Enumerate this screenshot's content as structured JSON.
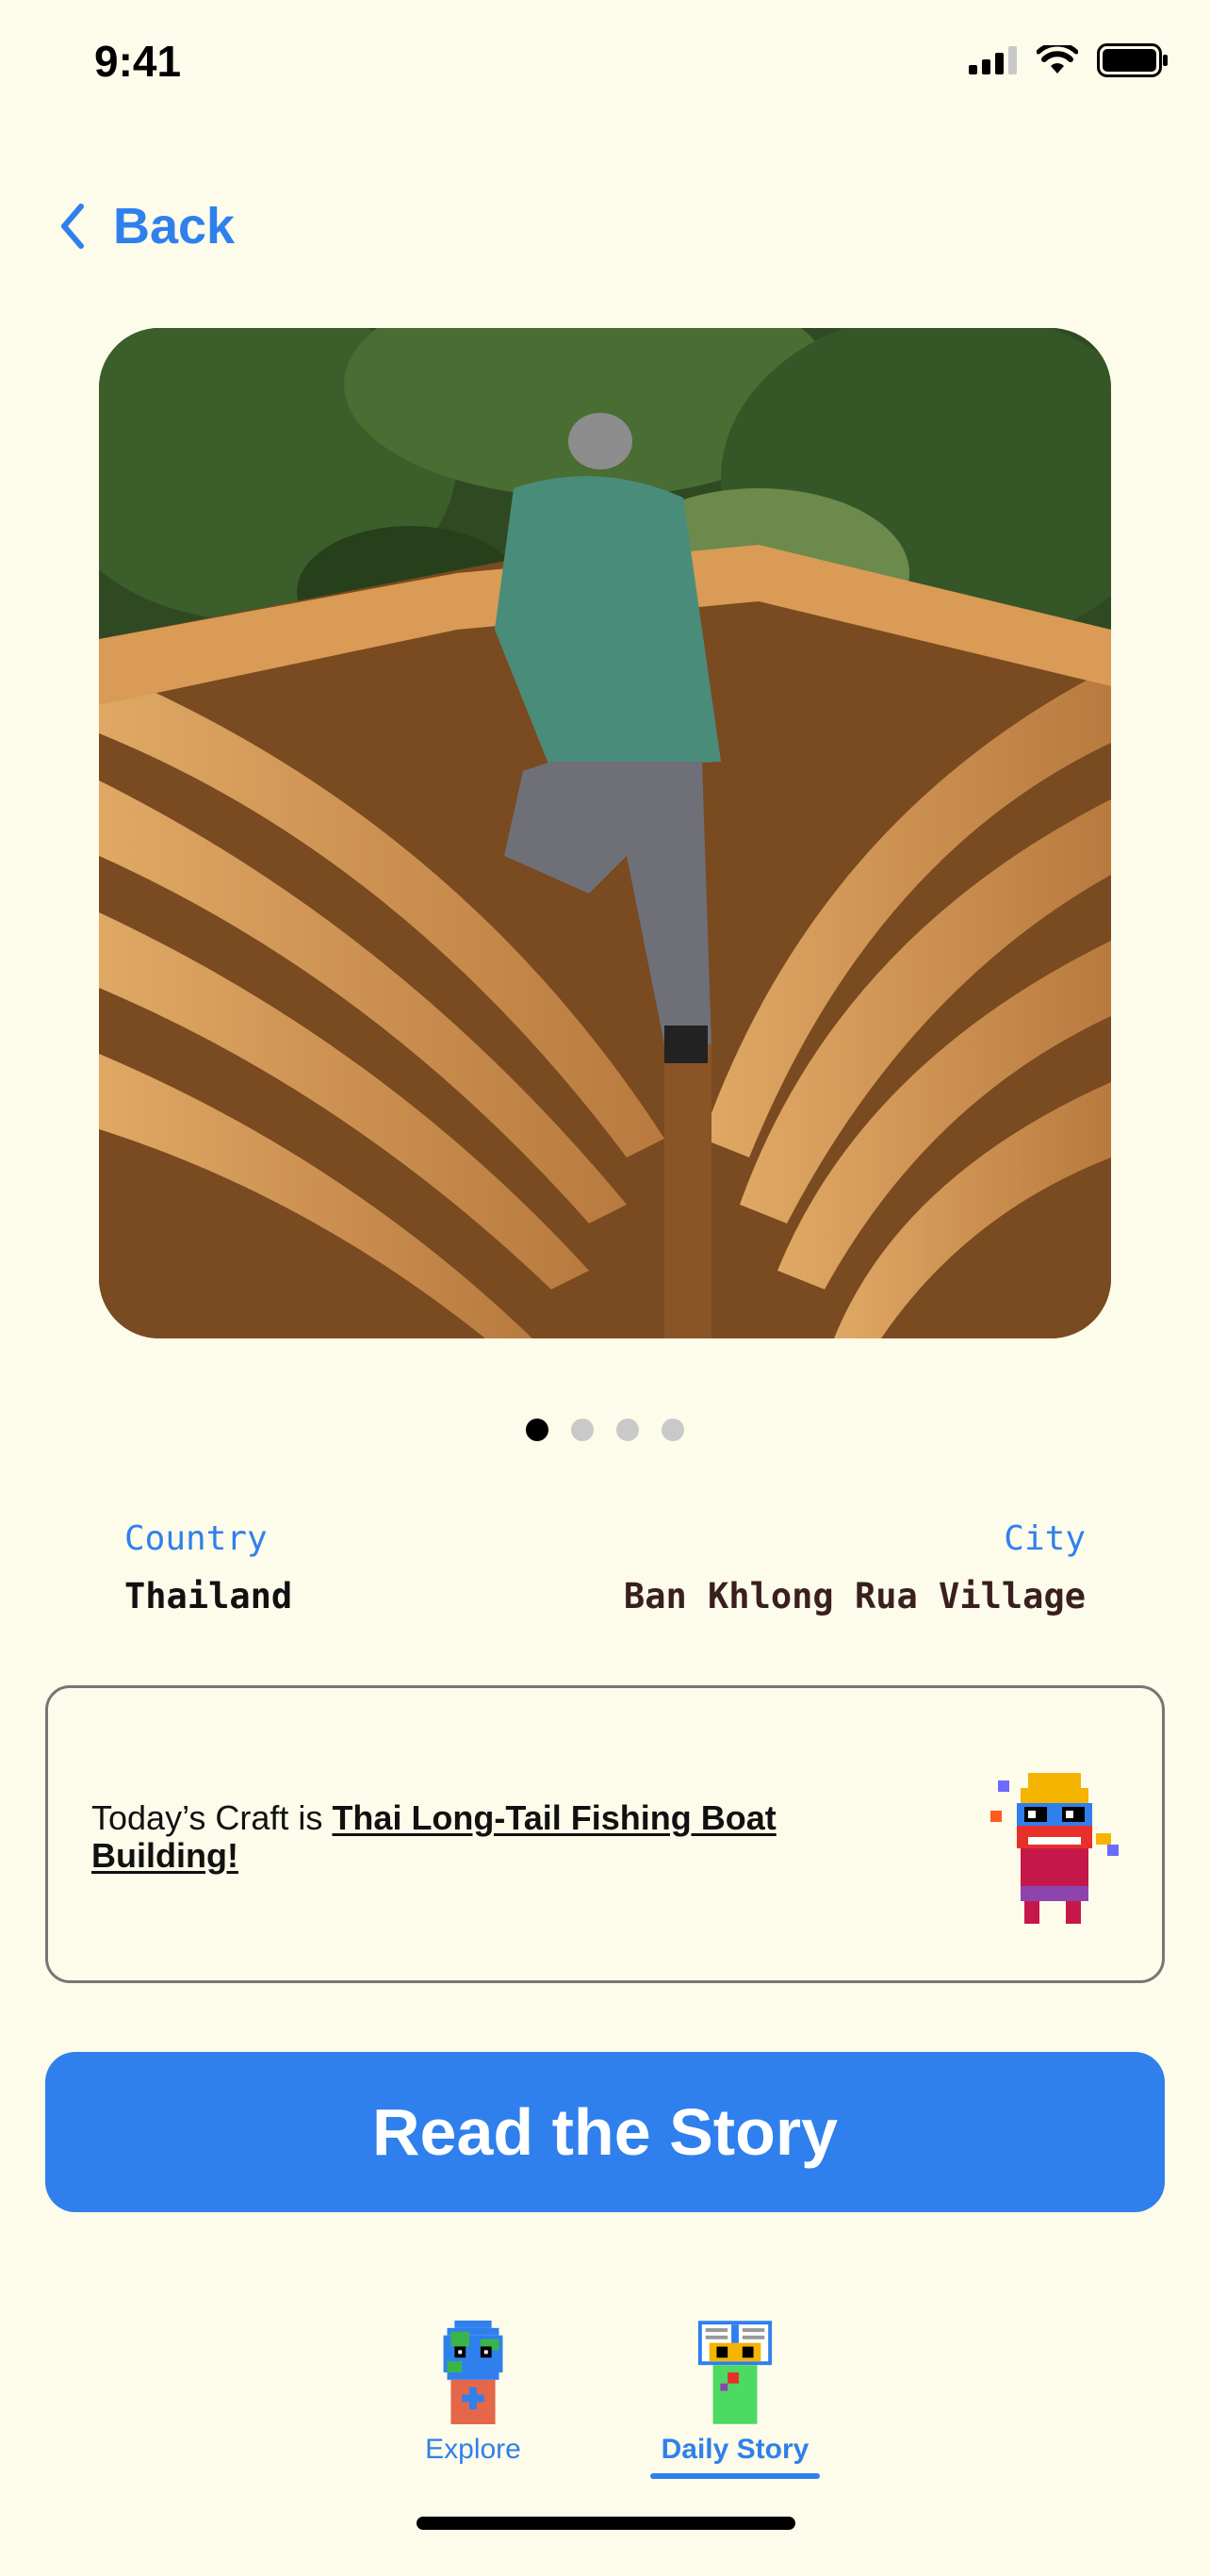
{
  "status_bar": {
    "time": "9:41",
    "icons": [
      "cellular-signal-icon",
      "wifi-icon",
      "battery-icon"
    ]
  },
  "nav": {
    "back_label": "Back",
    "back_icon": "chevron-left-icon"
  },
  "hero": {
    "image": "wooden-boat-hull-photo",
    "pager_total": 4,
    "pager_active_index": 0
  },
  "info": {
    "country_label": "Country",
    "country_value": "Thailand",
    "city_label": "City",
    "city_value": "Ban Khlong Rua Village"
  },
  "craft": {
    "prefix": "Today’s Craft is ",
    "name": "Thai Long-Tail Fishing Boat Building!",
    "mascot": "pixel-mascot-icon"
  },
  "cta": {
    "label": "Read the Story"
  },
  "tabbar": {
    "tabs": [
      {
        "label": "Explore",
        "icon": "globe-mascot-icon",
        "active": false
      },
      {
        "label": "Daily Story",
        "icon": "book-mascot-icon",
        "active": true
      }
    ]
  },
  "colors": {
    "background": "#fdfbea",
    "accent": "#2f80ed",
    "value_text": "#3a1f1f",
    "card_border": "#767676"
  }
}
